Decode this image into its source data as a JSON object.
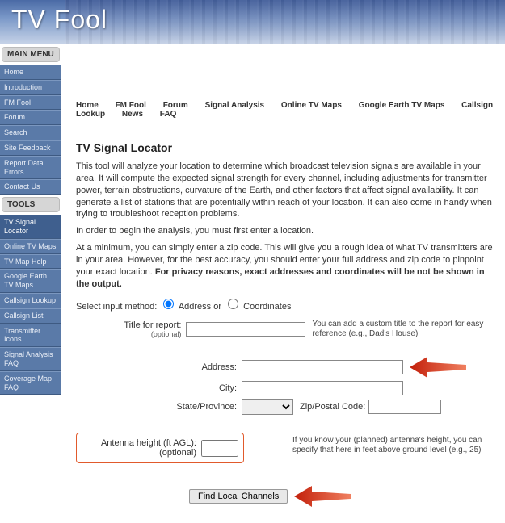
{
  "brand": "TV Fool",
  "sidebar": {
    "main_header": "MAIN MENU",
    "main_items": [
      "Home",
      "Introduction",
      "FM Fool",
      "Forum",
      "Search",
      "Site Feedback",
      "Report Data Errors",
      "Contact Us"
    ],
    "tools_header": "TOOLS",
    "tools_items": [
      "TV Signal Locator",
      "Online TV Maps",
      "TV Map Help",
      "Google Earth TV Maps",
      "Callsign Lookup",
      "Callsign List",
      "Transmitter Icons",
      "Signal Analysis FAQ",
      "Coverage Map FAQ"
    ]
  },
  "topnav": [
    "Home",
    "FM Fool",
    "Forum",
    "Signal Analysis",
    "Online TV Maps",
    "Google Earth TV Maps",
    "Callsign Lookup",
    "News",
    "FAQ"
  ],
  "page": {
    "title": "TV Signal Locator",
    "p1": "This tool will analyze your location to determine which broadcast television signals are available in your area.  It will compute the expected signal strength for every channel, including adjustments for transmitter power, terrain obstructions, curvature of the Earth, and other factors that affect signal availability.  It can generate a list of stations that are potentially within reach of your location.  It can also come in handy when trying to troubleshoot reception problems.",
    "p2": "In order to begin the analysis, you must first enter a location.",
    "p3a": "At a minimum, you can simply enter a zip code.  This will give you a rough idea of what TV transmitters are in your area.  However, for the best accuracy, you should enter your full address and zip code to pinpoint your exact location.  ",
    "p3b": "For privacy reasons, exact addresses and coordinates will be not be shown in the output.",
    "select_label": "Select input method:",
    "opt_address": "Address or",
    "opt_coords": "Coordinates",
    "title_label": "Title for report:",
    "optional": "(optional)",
    "title_hint": "You can add a custom title to the report for easy reference (e.g., Dad's House)",
    "address_label": "Address:",
    "city_label": "City:",
    "state_label": "State/Province:",
    "zip_label": "Zip/Postal Code:",
    "antenna_label": "Antenna height (ft AGL):",
    "antenna_hint": "If you know your (planned) antenna's height, you can specify that here in feet above ground level (e.g., 25)",
    "submit": "Find Local Channels"
  }
}
